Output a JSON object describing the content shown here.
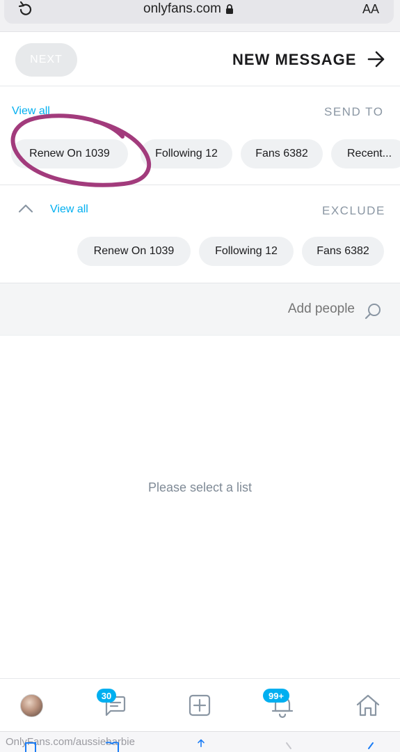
{
  "browser": {
    "domain": "onlyfans.com",
    "text_size_label": "AA",
    "bottom_url": "OnlyFans.com/aussiebarbie"
  },
  "header": {
    "title": "NEW MESSAGE",
    "next_label": "NEXT"
  },
  "send_to": {
    "label": "SEND TO",
    "view_all": "View all",
    "chips": [
      "Recent...",
      "Fans 6382",
      "Following 12",
      "Renew On 1039"
    ]
  },
  "exclude": {
    "label": "EXCLUDE",
    "view_all": "View all",
    "chips": [
      "Fans 6382",
      "Following 12",
      "Renew On 1039"
    ]
  },
  "search": {
    "placeholder": "Add people"
  },
  "empty_message": "Please select a list",
  "bottom_nav": {
    "messages_badge": "30",
    "notifications_badge": "99+"
  },
  "colors": {
    "accent": "#00aff0",
    "annotation": "#a23b7c",
    "chip_bg": "#eff1f3",
    "muted_text": "#8a96a3"
  }
}
